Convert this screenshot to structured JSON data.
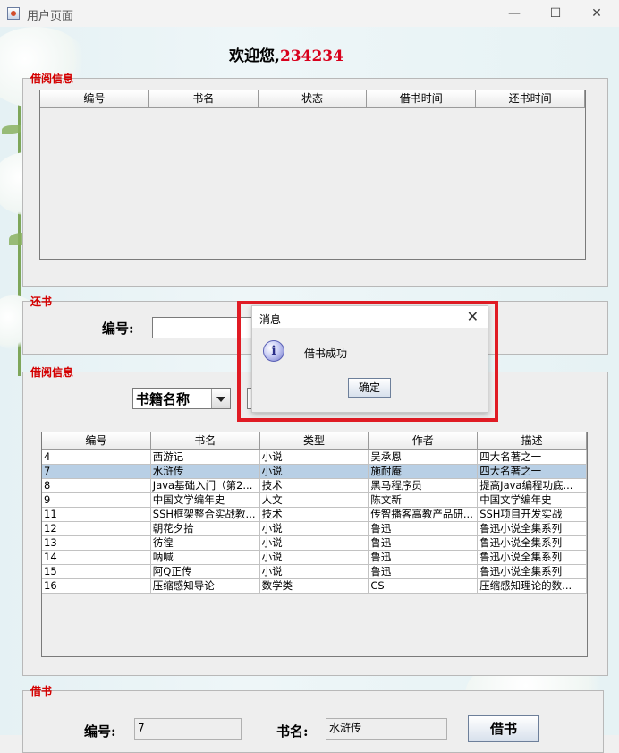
{
  "window": {
    "title": "用户页面",
    "min_glyph": "—",
    "max_glyph": "☐",
    "close_glyph": "✕"
  },
  "welcome": {
    "text": "欢迎您,",
    "username": "234234"
  },
  "borrow_info_top": {
    "legend": "借阅信息",
    "columns": [
      "编号",
      "书名",
      "状态",
      "借书时间",
      "还书时间"
    ],
    "rows": []
  },
  "return_section": {
    "legend": "还书",
    "id_label": "编号:",
    "id_value": ""
  },
  "book_list": {
    "legend": "借阅信息",
    "search_field": "书籍名称",
    "columns": [
      "编号",
      "书名",
      "类型",
      "作者",
      "描述"
    ],
    "selected_index": 1,
    "rows": [
      [
        "4",
        "西游记",
        "小说",
        "吴承恩",
        "四大名著之一"
      ],
      [
        "7",
        "水浒传",
        "小说",
        "施耐庵",
        "四大名著之一"
      ],
      [
        "8",
        "Java基础入门（第2...",
        "技术",
        "黑马程序员",
        "提高Java编程功底..."
      ],
      [
        "9",
        "中国文学编年史",
        "人文",
        "陈文新",
        "中国文学编年史"
      ],
      [
        "11",
        "SSH框架整合实战教...",
        "技术",
        "传智播客高教产品研...",
        "SSH项目开发实战"
      ],
      [
        "12",
        "朝花夕拾",
        "小说",
        "鲁迅",
        "鲁迅小说全集系列"
      ],
      [
        "13",
        "彷徨",
        "小说",
        "鲁迅",
        "鲁迅小说全集系列"
      ],
      [
        "14",
        "呐喊",
        "小说",
        "鲁迅",
        "鲁迅小说全集系列"
      ],
      [
        "15",
        "阿Q正传",
        "小说",
        "鲁迅",
        "鲁迅小说全集系列"
      ],
      [
        "16",
        "压缩感知导论",
        "数学类",
        "CS",
        "压缩感知理论的数..."
      ]
    ]
  },
  "borrow_section": {
    "legend": "借书",
    "id_label": "编号:",
    "id_value": "7",
    "name_label": "书名:",
    "name_value": "水浒传",
    "button_label": "借书"
  },
  "dialog": {
    "title": "消息",
    "message": "借书成功",
    "ok_label": "确定",
    "close_glyph": "✕"
  },
  "colors": {
    "legend": "#d40000",
    "username": "#d8001c",
    "highlight": "#e01b24",
    "selected_row": "#b8cfe5"
  }
}
